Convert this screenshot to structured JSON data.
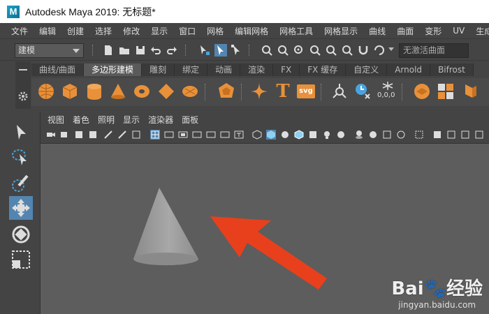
{
  "window": {
    "title": "Autodesk Maya 2019: 无标题*",
    "logo_letter": "M",
    "accent": "#1aa3c8"
  },
  "menubar": {
    "items": [
      "文件",
      "编辑",
      "创建",
      "选择",
      "修改",
      "显示",
      "窗口",
      "网格",
      "编辑网格",
      "网格工具",
      "网格显示",
      "曲线",
      "曲面",
      "变形",
      "UV",
      "生成"
    ]
  },
  "statusline": {
    "mode": "建模",
    "object_field_placeholder": "无激活曲面"
  },
  "shelf": {
    "tabs": [
      "曲线/曲面",
      "多边形建模",
      "雕刻",
      "绑定",
      "动画",
      "渲染",
      "FX",
      "FX 缓存",
      "自定义",
      "Arnold",
      "Bifrost"
    ],
    "active_tab": "多边形建模",
    "svg_label": "svg",
    "text_tool_label": "T",
    "counter_label": "0,0,0"
  },
  "viewport": {
    "menu": [
      "视图",
      "着色",
      "照明",
      "显示",
      "渲染器",
      "面板"
    ],
    "object": "cone",
    "background": "#5d5d5d",
    "arrow_color": "#e8401c"
  },
  "watermark": {
    "brand": "Bai🐾经验",
    "url": "jingyan.baidu.com"
  }
}
